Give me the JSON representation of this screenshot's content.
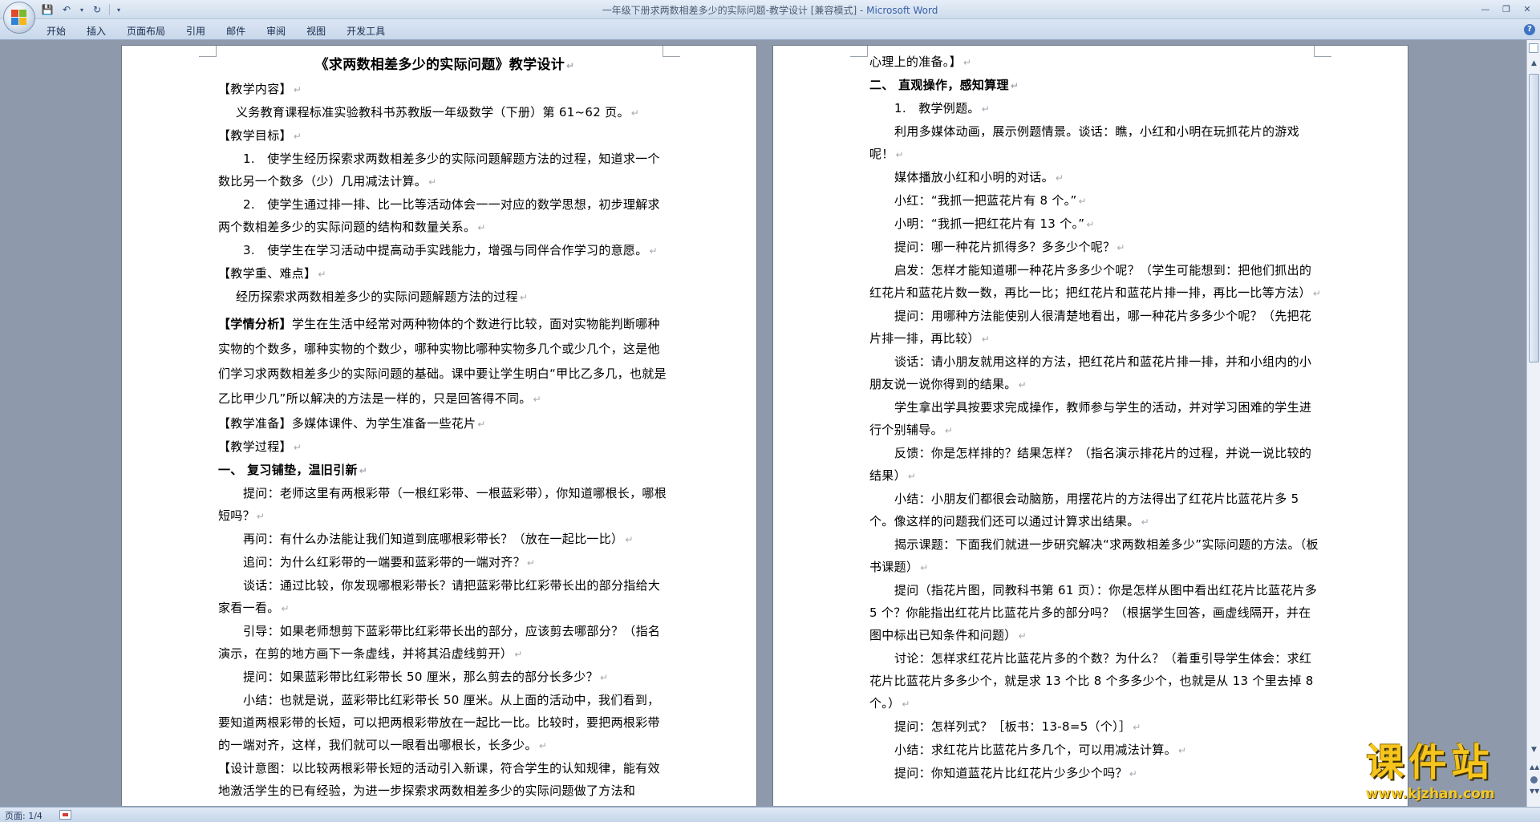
{
  "window": {
    "title_doc": "一年级下册求两数相差多少的实际问题-教学设计 [兼容模式] - ",
    "title_app": "Microsoft Word"
  },
  "ribbon": {
    "tabs": [
      "开始",
      "插入",
      "页面布局",
      "引用",
      "邮件",
      "审阅",
      "视图",
      "开发工具"
    ]
  },
  "page_left": {
    "title": "《求两数相差多少的实际问题》教学设计",
    "content_head": "【教学内容】",
    "content": "义务教育课程标准实验教科书苏教版一年级数学（下册）第 61~62 页。",
    "goal_head": "【教学目标】",
    "goals": [
      "1.　使学生经历探索求两数相差多少的实际问题解题方法的过程，知道求一个数比另一个数多（少）几用减法计算。",
      "2.　使学生通过排一排、比一比等活动体会一一对应的数学思想，初步理解求两个数相差多少的实际问题的结构和数量关系。",
      "3.　使学生在学习活动中提高动手实践能力，增强与同伴合作学习的意愿。"
    ],
    "key_head": "【教学重、难点】",
    "key": "经历探索求两数相差多少的实际问题解题方法的过程",
    "analysis_head": "【学情分析】",
    "analysis": "学生在生活中经常对两种物体的个数进行比较，面对实物能判断哪种实物的个数多，哪种实物的个数少，哪种实物比哪种实物多几个或少几个，这是他们学习求两数相差多少的实际问题的基础。课中要让学生明白“甲比乙多几，也就是乙比甲少几”所以解决的方法是一样的，只是回答得不同。",
    "prep": "【教学准备】多媒体课件、为学生准备一些花片",
    "process_head": "【教学过程】",
    "section1": "一、 复习铺垫，温旧引新",
    "paras": [
      "提问：老师这里有两根彩带（一根红彩带、一根蓝彩带），你知道哪根长，哪根短吗？",
      "再问：有什么办法能让我们知道到底哪根彩带长？（放在一起比一比）",
      "追问：为什么红彩带的一端要和蓝彩带的一端对齐？",
      "谈话：通过比较，你发现哪根彩带长？请把蓝彩带比红彩带长出的部分指给大家看一看。",
      "引导：如果老师想剪下蓝彩带比红彩带长出的部分，应该剪去哪部分？（指名演示，在剪的地方画下一条虚线，并将其沿虚线剪开）",
      "提问：如果蓝彩带比红彩带长 50 厘米，那么剪去的部分长多少？",
      "小结：也就是说，蓝彩带比红彩带长 50 厘米。从上面的活动中，我们看到，要知道两根彩带的长短，可以把两根彩带放在一起比一比。比较时，要把两根彩带的一端对齐，这样，我们就可以一眼看出哪根长，长多少。"
    ],
    "design": "【设计意图：以比较两根彩带长短的活动引入新课，符合学生的认知规律，能有效地激活学生的已有经验，为进一步探索求两数相差多少的实际问题做了方法和"
  },
  "page_right": {
    "cont": "心理上的准备。】",
    "section2": "二、 直观操作，感知算理",
    "item1": "1.　教学例题。",
    "paras": [
      "利用多媒体动画，展示例题情景。谈话：瞧，小红和小明在玩抓花片的游戏呢！",
      "媒体播放小红和小明的对话。",
      "小红：“我抓一把蓝花片有 8 个。”",
      "小明：“我抓一把红花片有 13 个。”",
      "提问：哪一种花片抓得多？多多少个呢？",
      "启发：怎样才能知道哪一种花片多多少个呢？（学生可能想到：把他们抓出的红花片和蓝花片数一数，再比一比；把红花片和蓝花片排一排，再比一比等方法）",
      "提问：用哪种方法能使别人很清楚地看出，哪一种花片多多少个呢？（先把花片排一排，再比较）",
      "谈话：请小朋友就用这样的方法，把红花片和蓝花片排一排，并和小组内的小朋友说一说你得到的结果。",
      "学生拿出学具按要求完成操作，教师参与学生的活动，并对学习困难的学生进行个别辅导。",
      "反馈：你是怎样排的？结果怎样？（指名演示排花片的过程，并说一说比较的结果）",
      "小结：小朋友们都很会动脑筋，用摆花片的方法得出了红花片比蓝花片多 5 个。像这样的问题我们还可以通过计算求出结果。",
      "揭示课题：下面我们就进一步研究解决“求两数相差多少”实际问题的方法。（板书课题）",
      "提问（指花片图，同教科书第 61 页）：你是怎样从图中看出红花片比蓝花片多 5 个？你能指出红花片比蓝花片多的部分吗？（根据学生回答，画虚线隔开，并在图中标出已知条件和问题）",
      "讨论：怎样求红花片比蓝花片多的个数？为什么？（着重引导学生体会：求红花片比蓝花片多多少个，就是求 13 个比 8 个多多少个，也就是从 13 个里去掉 8 个。）",
      "提问：怎样列式？［板书：13-8=5（个）］",
      "小结：求红花片比蓝花片多几个，可以用减法计算。",
      "提问：你知道蓝花片比红花片少多少个吗？"
    ]
  },
  "status": {
    "page": "页面: 1/4"
  },
  "watermark": {
    "text": "课件站",
    "url": "www.kjzhan.com"
  }
}
